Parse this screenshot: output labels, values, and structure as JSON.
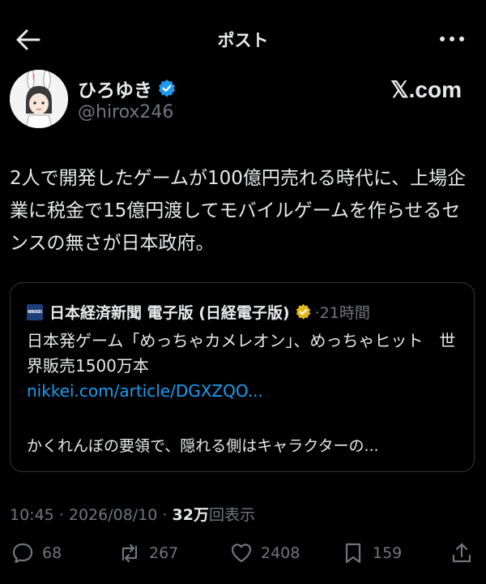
{
  "header": {
    "title": "ポスト"
  },
  "author": {
    "name": "ひろゆき",
    "handle": "@hirox246",
    "brand": "𝕏.com"
  },
  "post": {
    "text": "2人で開発したゲームが100億円売れる時代に、上場企業に税金で15億円渡してモバイルゲームを作らせるセンスの無さが日本政府。"
  },
  "quote": {
    "logo_text": "NIKKEI",
    "name": "日本経済新聞 電子版 (日経電子版)",
    "time": "·21時間",
    "text": "日本発ゲーム「めっちゃカメレオン」、めっちゃヒット　世界販売1500万本",
    "link": "nikkei.com/article/DGXZQO...",
    "preview": "かくれんぼの要領で、隠れる側はキャラクターの..."
  },
  "meta": {
    "timestamp": "10:45 · 2026/08/10 · ",
    "views_count": "32万",
    "views_label": "回表示"
  },
  "actions": {
    "replies": "68",
    "reposts": "267",
    "likes": "2408",
    "bookmarks": "159"
  },
  "colors": {
    "background": "#000000",
    "text": "#e7e9ea",
    "muted": "#71767b",
    "link": "#1d9bf0",
    "verified_blue": "#1d9bf0",
    "verified_gold": "#e2b719"
  }
}
